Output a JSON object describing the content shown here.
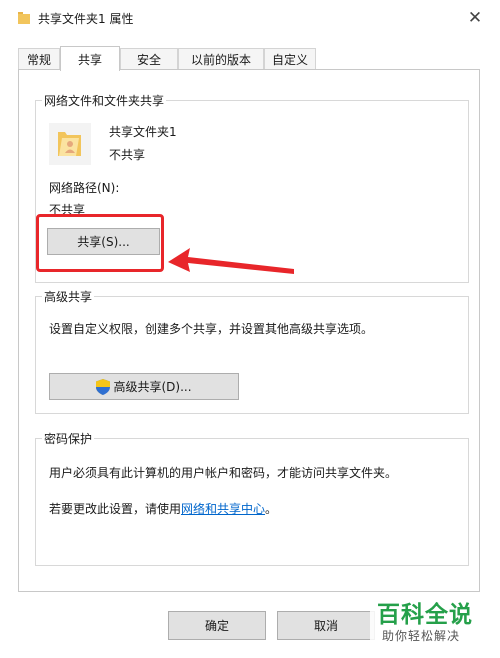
{
  "window": {
    "title": "共享文件夹1 属性",
    "close_glyph": "✕"
  },
  "tabs": [
    {
      "label": "常规",
      "active": false
    },
    {
      "label": "共享",
      "active": true
    },
    {
      "label": "安全",
      "active": false
    },
    {
      "label": "以前的版本",
      "active": false
    },
    {
      "label": "自定义",
      "active": false
    }
  ],
  "network_sharing": {
    "group_title": "网络文件和文件夹共享",
    "folder_name": "共享文件夹1",
    "folder_status": "不共享",
    "path_label": "网络路径(N):",
    "path_value": "不共享",
    "share_button": "共享(S)..."
  },
  "advanced_sharing": {
    "group_title": "高级共享",
    "description": "设置自定义权限，创建多个共享，并设置其他高级共享选项。",
    "button": "高级共享(D)..."
  },
  "password_protection": {
    "group_title": "密码保护",
    "line1": "用户必须具有此计算机的用户帐户和密码，才能访问共享文件夹。",
    "line2_prefix": "若要更改此设置，请使用",
    "line2_link": "网络和共享中心",
    "line2_suffix": "。"
  },
  "footer": {
    "ok": "确定",
    "cancel": "取消"
  },
  "watermark": {
    "title": "百科全说",
    "subtitle": "助你轻松解决"
  },
  "colors": {
    "highlight": "#e8262a",
    "link": "#0066cc",
    "watermark": "#25a04a"
  },
  "icons": [
    "folder-icon",
    "close-icon",
    "shield-icon",
    "shared-folder-icon",
    "arrow-annotation"
  ]
}
